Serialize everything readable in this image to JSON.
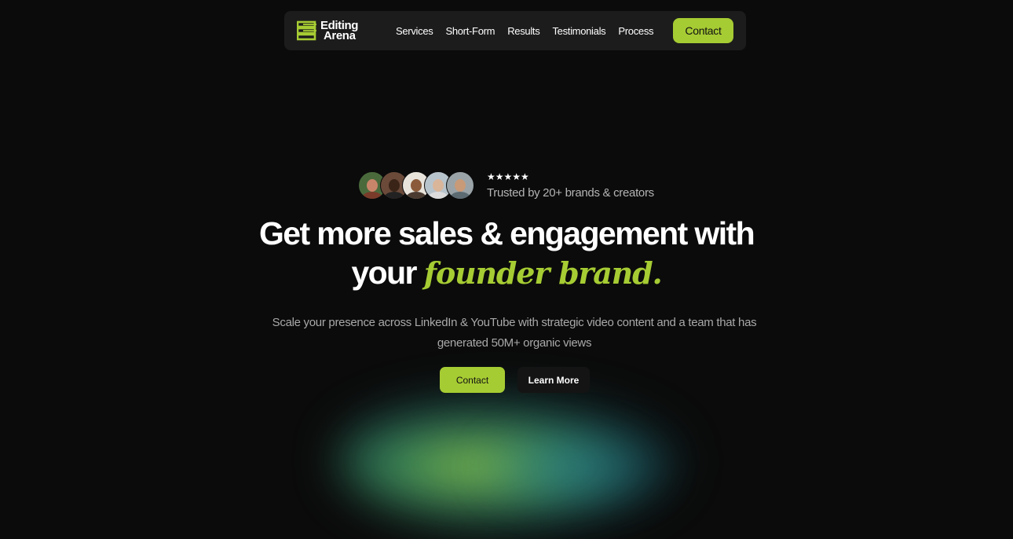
{
  "brand": {
    "logo_line1": "Editing",
    "logo_line2": "Arena",
    "logo_icon": "stacked-bars-logo-icon",
    "accent_color": "#a6cc33"
  },
  "nav": {
    "links": [
      "Services",
      "Short-Form",
      "Results",
      "Testimonials",
      "Process"
    ],
    "contact_label": "Contact"
  },
  "trust": {
    "stars": "★★★★★",
    "label": "Trusted by 20+ brands & creators",
    "avatar_count": 5
  },
  "hero": {
    "headline_part1": "Get more sales & engagement with",
    "headline_part2": "your",
    "headline_accent": "founder brand.",
    "subtext": "Scale your presence across LinkedIn & YouTube with strategic video content and a team that has generated 50M+ organic views",
    "primary_cta": "Contact",
    "secondary_cta": "Learn More"
  }
}
